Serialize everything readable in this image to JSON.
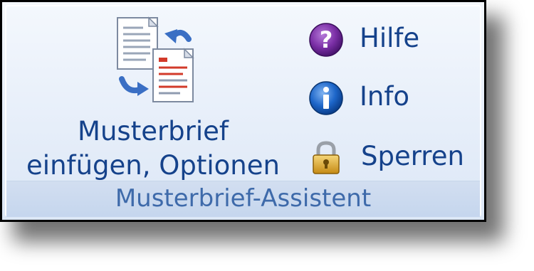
{
  "group": {
    "label": "Musterbrief-Assistent"
  },
  "big_button": {
    "label_line1": "Musterbrief",
    "label_line2": "einfügen, Optionen",
    "icon": "document-swap-icon"
  },
  "small_buttons": [
    {
      "label": "Hilfe",
      "icon": "help-question-icon",
      "icon_color": "#7b2fa6"
    },
    {
      "label": "Info",
      "icon": "info-icon",
      "icon_color": "#1d66c9"
    },
    {
      "label": "Sperren",
      "icon": "lock-icon",
      "icon_color": "#d9a520"
    }
  ],
  "colors": {
    "label_text": "#15428b",
    "group_label_text": "#3e6aaa",
    "panel_background": "#e9f0fa",
    "group_bar": "#c5d6ee"
  }
}
